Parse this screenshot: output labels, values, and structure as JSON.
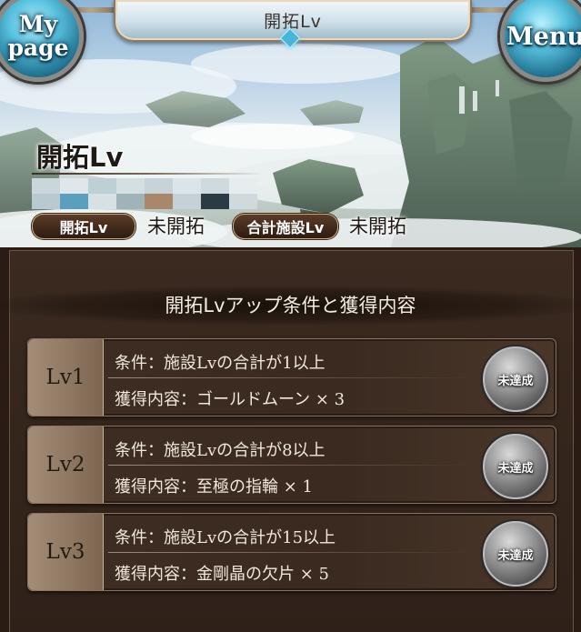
{
  "header": {
    "title": "開拓Lv",
    "mypage_label_line1": "My",
    "mypage_label_line2": "page",
    "menu_label": "Menu"
  },
  "banner": {
    "heading": "開拓Lv",
    "stats": [
      {
        "label": "開拓Lv",
        "value": "未開拓"
      },
      {
        "label": "合計施設Lv",
        "value": "未開拓"
      }
    ]
  },
  "section": {
    "title": "開拓Lvアップ条件と獲得内容"
  },
  "levels": [
    {
      "level": "Lv1",
      "condition": "条件：施設Lvの合計が1以上",
      "reward": "獲得内容：ゴールドムーン × 3",
      "status": "未達成"
    },
    {
      "level": "Lv2",
      "condition": "条件：施設Lvの合計が8以上",
      "reward": "獲得内容：至極の指輪 × 1",
      "status": "未達成"
    },
    {
      "level": "Lv3",
      "condition": "条件：施設Lvの合計が15以上",
      "reward": "獲得内容：金剛晶の欠片 × 5",
      "status": "未達成"
    }
  ],
  "colors": {
    "panel_bg": "#2f2119",
    "row_border": "#8a725e",
    "accent_gem": "#48b6d6"
  }
}
